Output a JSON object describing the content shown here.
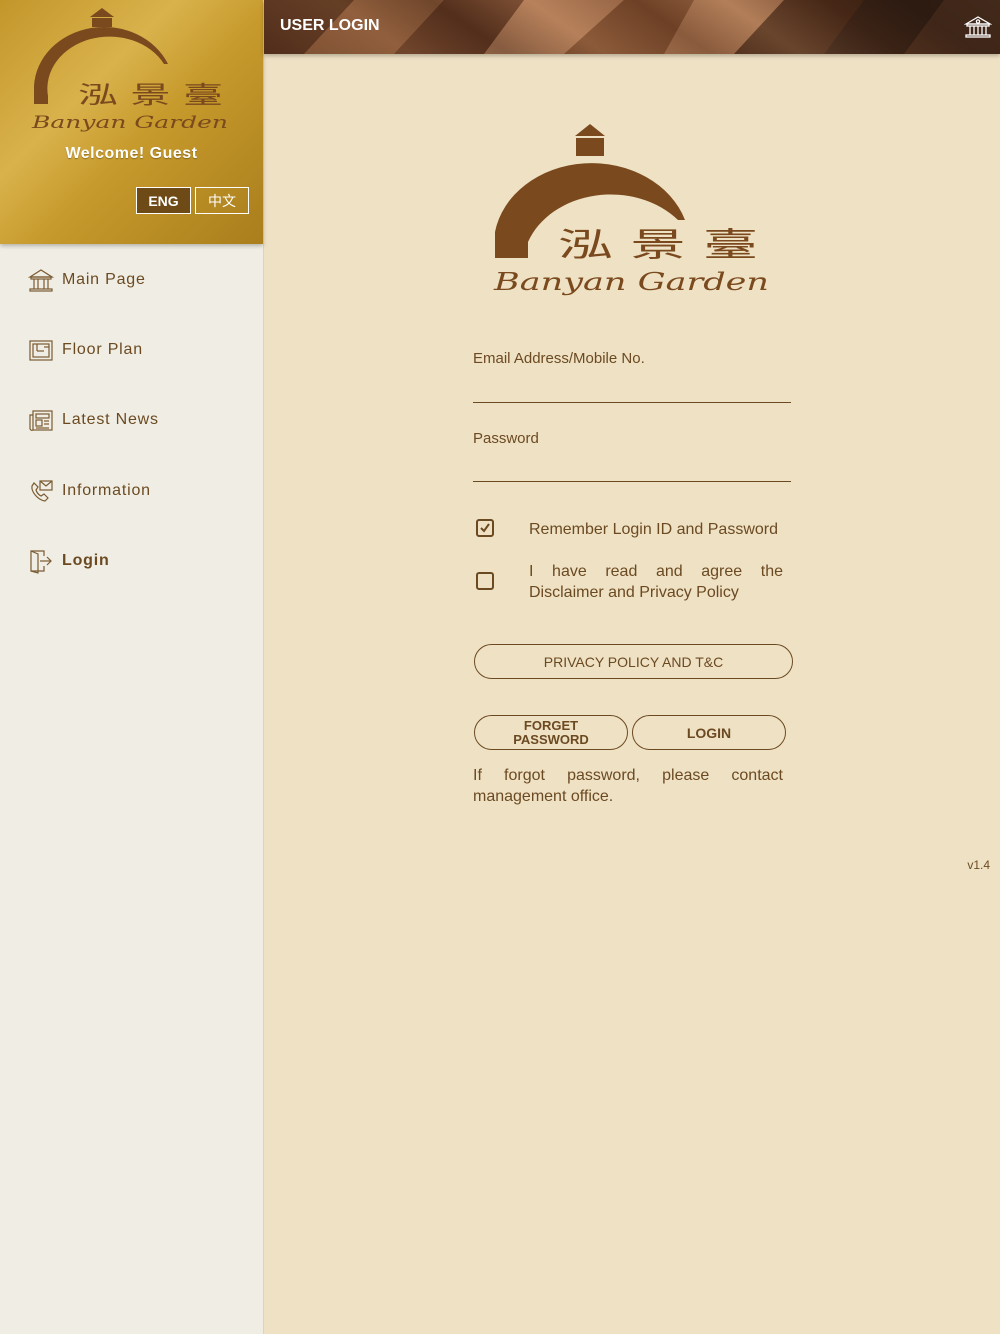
{
  "sidebar": {
    "logo": {
      "chinese_name": "泓 景 臺",
      "english_script": "Banyan Garden"
    },
    "welcome_text": "Welcome!  Guest",
    "language": {
      "english_label": "ENG",
      "chinese_label": "中文",
      "selected": "ENG"
    },
    "nav_items": [
      {
        "label": "Main Page",
        "icon": "building-icon"
      },
      {
        "label": "Floor Plan",
        "icon": "floor-plan-icon"
      },
      {
        "label": "Latest News",
        "icon": "newspaper-icon"
      },
      {
        "label": "Information",
        "icon": "phone-info-icon"
      },
      {
        "label": "Login",
        "icon": "door-login-icon"
      }
    ]
  },
  "header": {
    "title": "USER LOGIN",
    "home_icon": "building-icon"
  },
  "main": {
    "logo": {
      "chinese_name": "泓 景 臺",
      "english_script": "Banyan Garden"
    },
    "email_field": {
      "label": "Email Address/Mobile No.",
      "value": ""
    },
    "password_field": {
      "label": "Password",
      "value": ""
    },
    "remember_checkbox": {
      "label": "Remember Login ID and Password",
      "checked": true
    },
    "agree_checkbox": {
      "label": "I have read and agree the Disclaimer and Privacy Policy",
      "checked": false
    },
    "privacy_button": "PRIVACY POLICY AND T&C",
    "forget_button": "FORGET PASSWORD",
    "login_button": "LOGIN",
    "forgot_note": "If forgot password, please contact management office.",
    "version": "v1.4"
  },
  "colors": {
    "brand_brown": "#6b4a22",
    "gold": "#c79a2c",
    "background": "#efe1c4",
    "sidebar_bg": "#f0eee4"
  }
}
